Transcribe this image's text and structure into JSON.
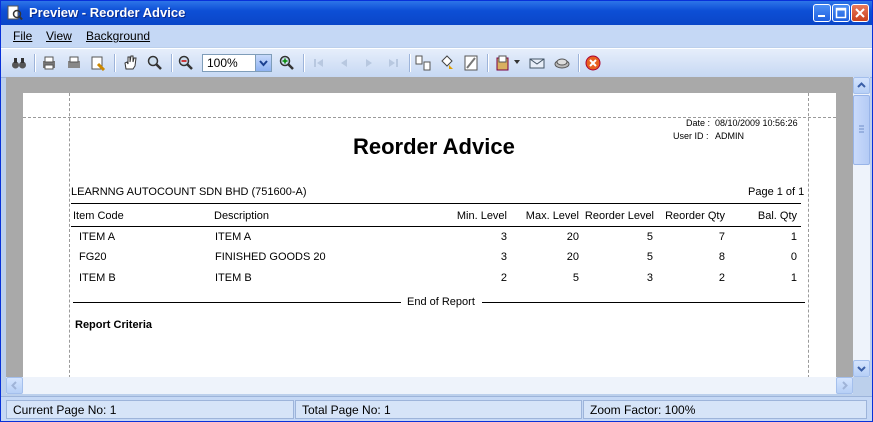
{
  "window": {
    "title": "Preview - Reorder Advice",
    "controls": [
      "minimize-icon",
      "maximize-icon",
      "close-icon"
    ]
  },
  "menu": [
    "File",
    "View",
    "Background"
  ],
  "toolbar": {
    "zoom_value": "100%",
    "icons": [
      "find-icon",
      "print-setup-icon",
      "print-icon",
      "quick-print-icon",
      "hand-tool-icon",
      "zoom-tool-icon",
      "zoom-out-icon",
      "zoom-in-icon",
      "first-page-icon",
      "prev-page-icon",
      "next-page-icon",
      "last-page-icon",
      "multiple-pages-icon",
      "background-color-icon",
      "watermark-icon",
      "export-icon",
      "send-email-icon",
      "open-icon",
      "close-preview-icon"
    ]
  },
  "report": {
    "date_label": "Date :",
    "date_value": "08/10/2009 10:56:26",
    "user_label": "User ID :",
    "user_value": "ADMIN",
    "title": "Reorder Advice",
    "company": "LEARNNG AUTOCOUNT SDN BHD (751600-A)",
    "page": "Page 1 of 1",
    "columns": [
      "Item Code",
      "Description",
      "Min. Level",
      "Max. Level",
      "Reorder Level",
      "Reorder Qty",
      "Bal. Qty"
    ],
    "rows": [
      [
        "ITEM A",
        "ITEM A",
        "3",
        "20",
        "5",
        "7",
        "1"
      ],
      [
        "FG20",
        "FINISHED GOODS 20",
        "3",
        "20",
        "5",
        "8",
        "0"
      ],
      [
        "ITEM B",
        "ITEM B",
        "2",
        "5",
        "3",
        "2",
        "1"
      ]
    ],
    "end_text": "End of Report",
    "criteria_title": "Report Criteria"
  },
  "status": {
    "current_page": "Current Page No: 1",
    "total_page": "Total Page No: 1",
    "zoom_factor": "Zoom Factor: 100%"
  }
}
